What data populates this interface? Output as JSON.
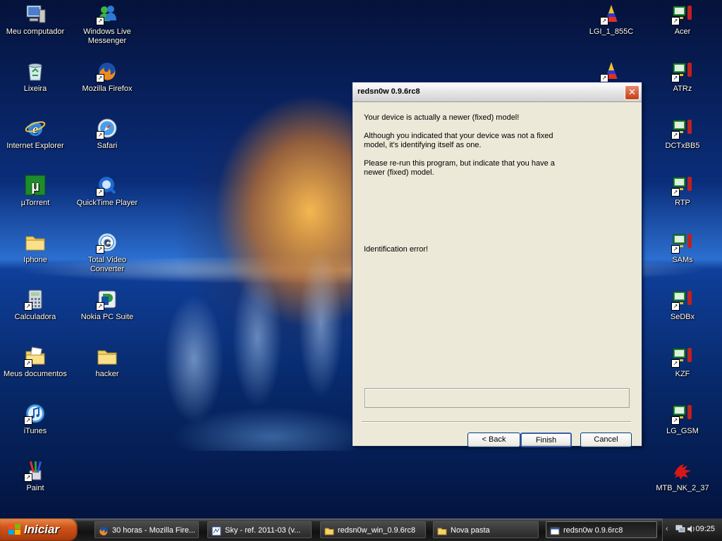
{
  "desktop": {
    "icons_left": [
      {
        "label": "Meu computador",
        "icon": "my-computer-icon"
      },
      {
        "label": "Lixeira",
        "icon": "recycle-bin-icon"
      },
      {
        "label": "Internet Explorer",
        "icon": "internet-explorer-icon"
      },
      {
        "label": "µTorrent",
        "icon": "utorrent-icon"
      },
      {
        "label": "Iphone",
        "icon": "folder-icon"
      },
      {
        "label": "Calculadora",
        "icon": "calculator-icon"
      },
      {
        "label": "Meus documentos",
        "icon": "my-documents-icon"
      },
      {
        "label": "iTunes",
        "icon": "itunes-icon"
      },
      {
        "label": "Paint",
        "icon": "paint-icon"
      }
    ],
    "icons_col2": [
      {
        "label": "Windows Live Messenger",
        "icon": "messenger-icon"
      },
      {
        "label": "Mozilla Firefox",
        "icon": "firefox-icon"
      },
      {
        "label": "Safari",
        "icon": "safari-icon"
      },
      {
        "label": "QuickTime Player",
        "icon": "quicktime-icon"
      },
      {
        "label": "Total Video Converter",
        "icon": "video-converter-icon"
      },
      {
        "label": "Nokia PC Suite",
        "icon": "nokia-pc-suite-icon"
      },
      {
        "label": "hacker",
        "icon": "folder-icon"
      }
    ],
    "icons_right_inner": [
      {
        "label": "LGI_1_855C",
        "icon": "lg-tool-icon"
      },
      {
        "label": "",
        "icon": "lg-tool-icon"
      }
    ],
    "icons_right": [
      {
        "label": "Acer",
        "icon": "phone-tool-icon"
      },
      {
        "label": "ATRz",
        "icon": "phone-tool-icon"
      },
      {
        "label": "DCTxBB5",
        "icon": "phone-tool-icon"
      },
      {
        "label": "RTP",
        "icon": "phone-tool-icon"
      },
      {
        "label": "SAMs",
        "icon": "phone-tool-icon"
      },
      {
        "label": "SeDBx",
        "icon": "phone-tool-icon"
      },
      {
        "label": "KZF",
        "icon": "phone-tool-icon"
      },
      {
        "label": "LG_GSM",
        "icon": "phone-tool-icon"
      },
      {
        "label": "MTB_NK_2_37",
        "icon": "dragon-icon"
      }
    ]
  },
  "dialog": {
    "title": "redsn0w 0.9.6rc8",
    "close_glyph": "✕",
    "message_1": "Your device is actually a newer (fixed) model!",
    "message_2": "Although you indicated that your device was not a fixed model, it's identifying itself as one.",
    "message_3": "Please re-run this program, but indicate that you have a newer (fixed) model.",
    "message_4": "Identification error!",
    "back_label": "< Back",
    "finish_label": "Finish",
    "cancel_label": "Cancel"
  },
  "taskbar": {
    "start_label": "Iniciar",
    "tasks": [
      {
        "label": "30 horas - Mozilla Fire...",
        "icon": "firefox-icon"
      },
      {
        "label": "Sky - ref. 2011-03 (v...",
        "icon": "document-icon"
      },
      {
        "label": "redsn0w_win_0.9.6rc8",
        "icon": "folder-icon"
      },
      {
        "label": "Nova pasta",
        "icon": "folder-icon"
      },
      {
        "label": "redsn0w 0.9.6rc8",
        "icon": "window-icon"
      }
    ],
    "tray_chevron": "‹",
    "clock": "09:25"
  },
  "colors": {
    "dialog_bg": "#ece9d8",
    "start_orange": "#d0541a",
    "desktop_blue": "#0a2d7a"
  }
}
